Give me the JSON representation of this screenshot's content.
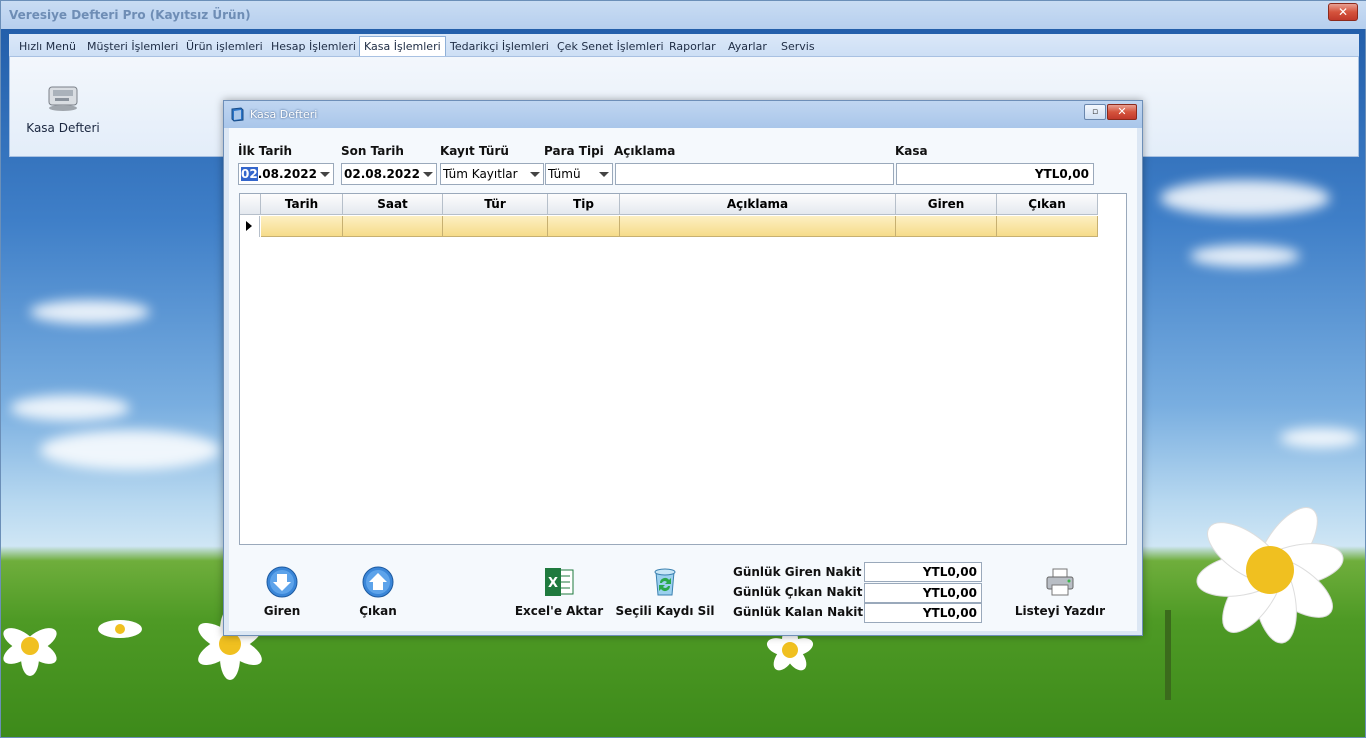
{
  "window": {
    "title": "Veresiye Defteri Pro (Kayıtsız Ürün)",
    "close_label": "✕"
  },
  "tabs": [
    {
      "label": "Hızlı Menü"
    },
    {
      "label": "Müşteri İşlemleri"
    },
    {
      "label": "Ürün işlemleri"
    },
    {
      "label": "Hesap İşlemleri"
    },
    {
      "label": "Kasa İşlemleri"
    },
    {
      "label": "Tedarikçi İşlemleri"
    },
    {
      "label": "Çek Senet İşlemleri"
    },
    {
      "label": "Raporlar"
    },
    {
      "label": "Ayarlar"
    },
    {
      "label": "Servis"
    }
  ],
  "active_tab": "Kasa İşlemleri",
  "ribbon": {
    "kasa_defteri_label": "Kasa Defteri",
    "icon": "cash-register-icon"
  },
  "dialog": {
    "title": "Kasa Defteri",
    "max_label": "▫",
    "close_label": "✕",
    "filters": {
      "ilk_tarih_label": "İlk Tarih",
      "ilk_tarih_day": "02",
      "ilk_tarih_rest": ".08.2022",
      "son_tarih_label": "Son Tarih",
      "son_tarih_value": "02.08.2022",
      "kayit_turu_label": "Kayıt Türü",
      "kayit_turu_value": "Tüm Kayıtlar",
      "para_tipi_label": "Para Tipi",
      "para_tipi_value": "Tümü",
      "aciklama_label": "Açıklama",
      "aciklama_value": "",
      "kasa_label": "Kasa",
      "kasa_value": "YTL0,00"
    },
    "grid": {
      "columns": [
        "Tarih",
        "Saat",
        "Tür",
        "Tip",
        "Açıklama",
        "Giren",
        "Çıkan"
      ],
      "rows": [
        [
          "",
          "",
          "",
          "",
          "",
          "",
          ""
        ]
      ]
    },
    "buttons": {
      "giren": "Giren",
      "cikan": "Çıkan",
      "excel": "Excel'e Aktar",
      "sil": "Seçili Kaydı Sil",
      "yazdir": "Listeyi Yazdır"
    },
    "summary": {
      "giren_label": "Günlük Giren Nakit",
      "giren_value": "YTL0,00",
      "cikan_label": "Günlük Çıkan Nakit",
      "cikan_value": "YTL0,00",
      "kalan_label": "Günlük Kalan Nakit",
      "kalan_value": "YTL0,00"
    }
  }
}
